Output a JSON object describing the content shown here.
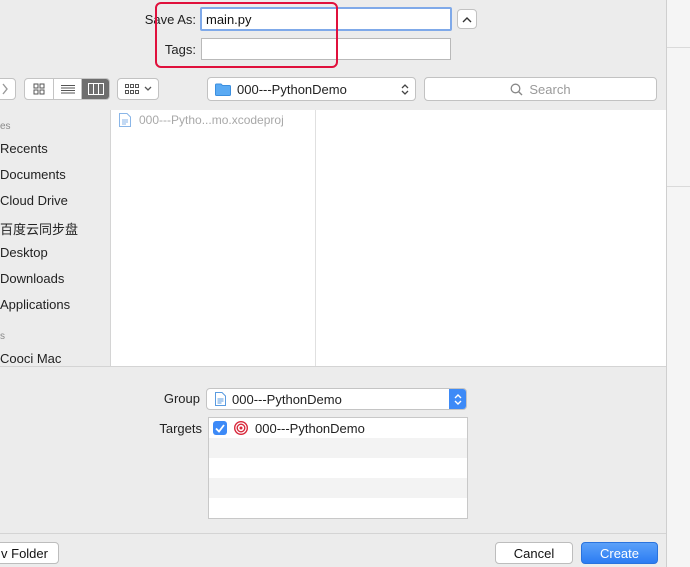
{
  "form": {
    "save_as_label": "Save As:",
    "save_as_value": "main.py",
    "tags_label": "Tags:",
    "tags_value": ""
  },
  "toolbar": {
    "location": "000---PythonDemo",
    "search_placeholder": "Search"
  },
  "sidebar": {
    "favorites_header": "es",
    "items": [
      "Recents",
      "Documents",
      "Cloud Drive",
      "百度云同步盘",
      "Desktop",
      "Downloads",
      "Applications"
    ],
    "devices_header": "s",
    "devices": [
      "Cooci Mac"
    ]
  },
  "browser": {
    "files": [
      "000---Pytho...mo.xcodeproj"
    ]
  },
  "options": {
    "group_label": "Group",
    "group_value": "000---PythonDemo",
    "targets_label": "Targets",
    "targets": [
      {
        "name": "000---PythonDemo",
        "checked": true
      }
    ]
  },
  "footer": {
    "new_folder_label": "v Folder",
    "cancel_label": "Cancel",
    "create_label": "Create"
  },
  "colors": {
    "accent": "#3d8af7",
    "highlight": "#e0103c",
    "window_bg": "#ececec"
  }
}
